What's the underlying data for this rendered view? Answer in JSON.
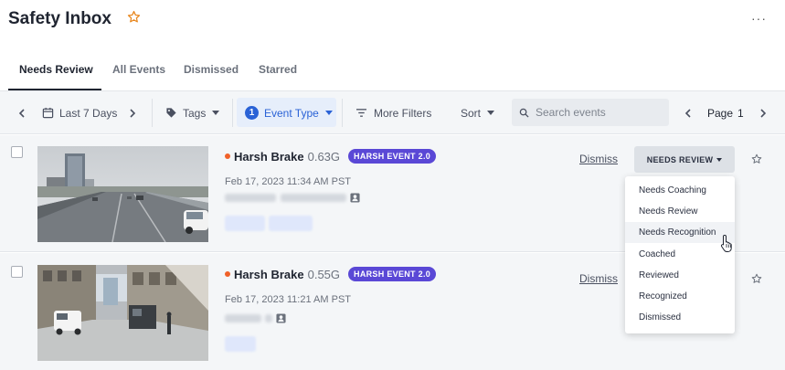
{
  "header": {
    "title": "Safety Inbox",
    "more_label": "···"
  },
  "tabs": [
    {
      "label": "Needs Review",
      "active": true
    },
    {
      "label": "All Events",
      "active": false
    },
    {
      "label": "Dismissed",
      "active": false
    },
    {
      "label": "Starred",
      "active": false
    }
  ],
  "toolbar": {
    "date_range": "Last 7 Days",
    "tags_label": "Tags",
    "event_type_label": "Event Type",
    "event_type_count": "1",
    "more_filters_label": "More Filters",
    "sort_label": "Sort",
    "search_placeholder": "Search events",
    "page_label": "Page",
    "page_number": "1"
  },
  "events": [
    {
      "name": "Harsh Brake",
      "g_force": "0.63G",
      "badge": "HARSH EVENT 2.0",
      "datetime": "Feb 17, 2023 11:34 AM PST",
      "dismiss_label": "Dismiss",
      "status_label": "NEEDS REVIEW"
    },
    {
      "name": "Harsh Brake",
      "g_force": "0.55G",
      "badge": "HARSH EVENT 2.0",
      "datetime": "Feb 17, 2023 11:21 AM PST",
      "dismiss_label": "Dismiss"
    }
  ],
  "status_dropdown": {
    "options": [
      "Needs Coaching",
      "Needs Review",
      "Needs Recognition",
      "Coached",
      "Reviewed",
      "Recognized",
      "Dismissed"
    ],
    "hovered": "Needs Recognition"
  },
  "colors": {
    "accent_blue": "#2a62d6",
    "badge_purple": "#5a48d6",
    "event_dot": "#f0612a",
    "star": "#e8871e"
  }
}
